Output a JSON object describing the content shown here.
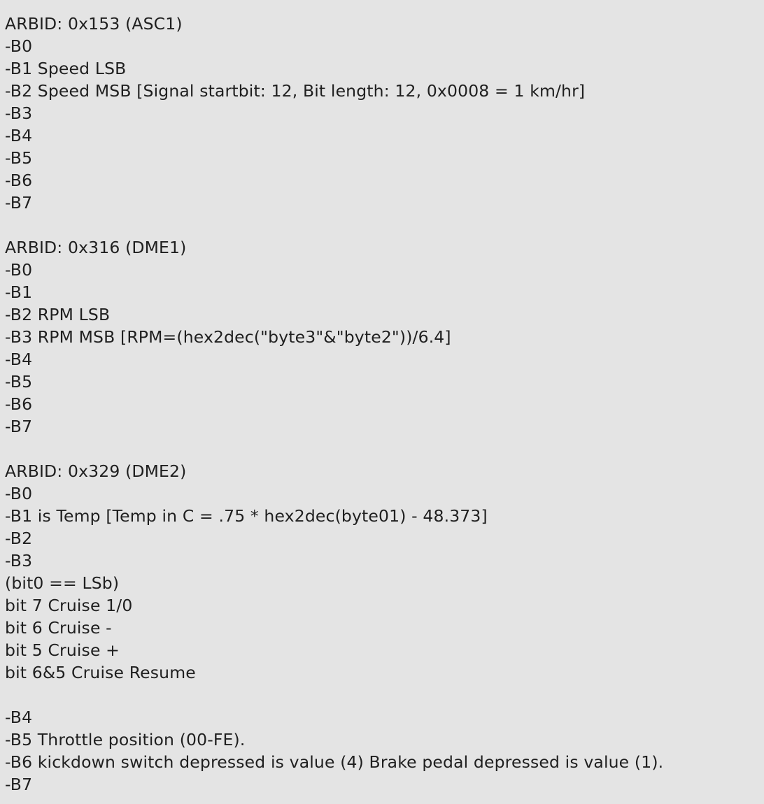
{
  "document": {
    "lines": [
      "ARBID: 0x153 (ASC1)",
      "-B0",
      "-B1 Speed LSB",
      "-B2 Speed MSB [Signal startbit: 12, Bit length: 12, 0x0008 = 1 km/hr]",
      "-B3",
      "-B4",
      "-B5",
      "-B6",
      "-B7",
      "",
      "ARBID: 0x316 (DME1)",
      "-B0",
      "-B1",
      "-B2 RPM LSB",
      "-B3 RPM MSB [RPM=(hex2dec(\"byte3\"&\"byte2\"))/6.4]",
      "-B4",
      "-B5",
      "-B6",
      "-B7",
      "",
      "ARBID: 0x329 (DME2)",
      "-B0",
      "-B1 is Temp [Temp in C = .75 * hex2dec(byte01) - 48.373]",
      "-B2",
      "-B3",
      "(bit0 == LSb)",
      "bit 7 Cruise 1/0",
      "bit 6 Cruise -",
      "bit 5 Cruise +",
      "bit 6&5 Cruise Resume",
      "",
      "-B4",
      "-B5 Throttle position (00-FE).",
      "-B6 kickdown switch depressed is value (4) Brake pedal depressed is value (1).",
      "-B7"
    ]
  }
}
